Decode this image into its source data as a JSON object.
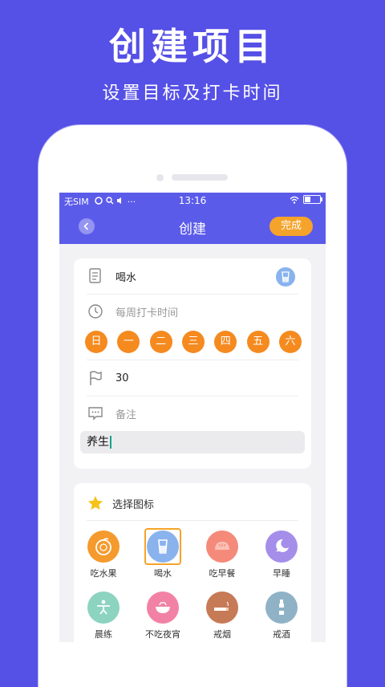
{
  "promo": {
    "title": "创建项目",
    "subtitle": "设置目标及打卡时间"
  },
  "status_bar": {
    "carrier": "无SIM",
    "time": "13:16",
    "battery_level": 0.4
  },
  "nav": {
    "title": "创建",
    "done_label": "完成",
    "back_icon": "chevron-left-icon"
  },
  "form": {
    "name_value": "喝水",
    "name_icon": "document-icon",
    "weekly_label": "每周打卡时间",
    "weekly_icon": "clock-icon",
    "days": [
      "日",
      "一",
      "二",
      "三",
      "四",
      "五",
      "六"
    ],
    "target_value": "30",
    "target_icon": "flag-icon",
    "note_placeholder": "备注",
    "note_icon": "comment-icon",
    "note_value": "养生"
  },
  "icon_picker": {
    "header_label": "选择图标",
    "header_icon": "star-icon",
    "items": [
      {
        "label": "吃水果",
        "color": "#F59A2D",
        "icon": "orange-icon"
      },
      {
        "label": "喝水",
        "color": "#8AB3EE",
        "icon": "water-cup-icon",
        "selected": true
      },
      {
        "label": "吃早餐",
        "color": "#F58A7A",
        "icon": "bun-icon"
      },
      {
        "label": "早睡",
        "color": "#A48EEA",
        "icon": "moon-icon"
      },
      {
        "label": "晨练",
        "color": "#8CD3C0",
        "icon": "exercise-icon"
      },
      {
        "label": "不吃夜宵",
        "color": "#F282A5",
        "icon": "bowl-icon"
      },
      {
        "label": "戒烟",
        "color": "#C67A56",
        "icon": "cigarette-icon"
      },
      {
        "label": "戒酒",
        "color": "#8FB2C6",
        "icon": "bottle-icon"
      }
    ]
  },
  "colors": {
    "brand": "#5550E6",
    "accent": "#F5A32A",
    "day_circle": "#F58A1F"
  }
}
